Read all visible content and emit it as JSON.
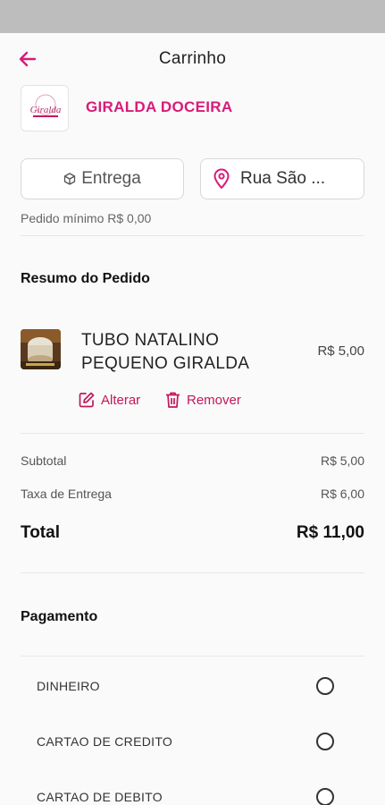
{
  "header": {
    "title": "Carrinho"
  },
  "store": {
    "name": "GIRALDA DOCEIRA",
    "logo_text": "Giralda"
  },
  "delivery": {
    "mode_label": "Entrega",
    "address_label": "Rua São ..."
  },
  "min_order": "Pedido mínimo R$ 0,00",
  "summary": {
    "title": "Resumo do Pedido",
    "item": {
      "name": "TUBO NATALINO PEQUENO GIRALDA",
      "price": "R$ 5,00",
      "edit_label": "Alterar",
      "remove_label": "Remover"
    },
    "subtotal_label": "Subtotal",
    "subtotal_value": "R$ 5,00",
    "fee_label": "Taxa de Entrega",
    "fee_value": "R$ 6,00",
    "total_label": "Total",
    "total_value": "R$ 11,00"
  },
  "payment": {
    "title": "Pagamento",
    "options": [
      "DINHEIRO",
      "CARTAO DE CREDITO",
      "CARTAO DE DEBITO"
    ]
  },
  "colors": {
    "accent": "#d81b78",
    "action": "#c2185b",
    "status_bar": "#bdbdbd"
  },
  "icons": {
    "back": "arrow-left-icon",
    "delivery": "box-icon",
    "address": "location-pin-icon",
    "edit": "edit-icon",
    "remove": "trash-icon"
  }
}
